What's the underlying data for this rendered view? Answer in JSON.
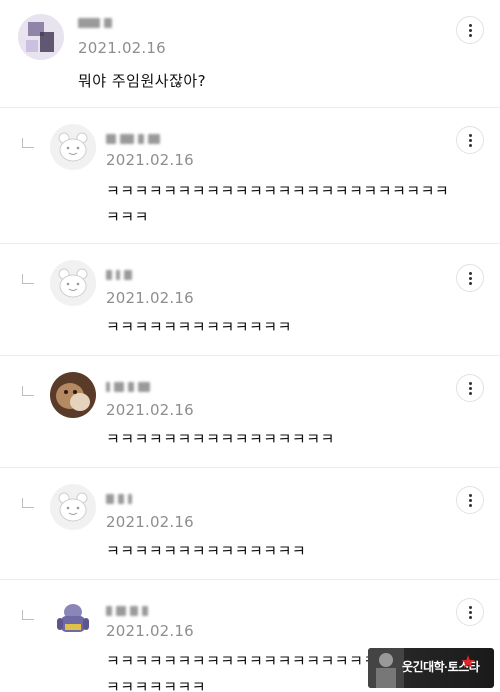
{
  "comments": [
    {
      "date": "2021.02.16",
      "text": "뭐야 주임원사잖아?"
    },
    {
      "date": "2021.02.16",
      "text": "ㅋㅋㅋㅋㅋㅋㅋㅋㅋㅋㅋㅋㅋㅋㅋㅋㅋㅋㅋㅋㅋㅋㅋㅋㅋㅋㅋ"
    },
    {
      "date": "2021.02.16",
      "text": "ㅋㅋㅋㅋㅋㅋㅋㅋㅋㅋㅋㅋㅋ"
    },
    {
      "date": "2021.02.16",
      "text": "ㅋㅋㅋㅋㅋㅋㅋㅋㅋㅋㅋㅋㅋㅋㅋㅋ"
    },
    {
      "date": "2021.02.16",
      "text": "ㅋㅋㅋㅋㅋㅋㅋㅋㅋㅋㅋㅋㅋㅋ"
    },
    {
      "date": "2021.02.16",
      "text": "ㅋㅋㅋㅋㅋㅋㅋㅋㅋㅋㅋㅋㅋㅋㅋㅋㅋㅋㅋㅋㅋㅋㅋㅋㅋㅋ"
    }
  ],
  "watermark": {
    "text": "웃긴대학·토스타"
  },
  "icons": {
    "more": "more-vertical-icon",
    "reply": "reply-arrow-icon"
  }
}
